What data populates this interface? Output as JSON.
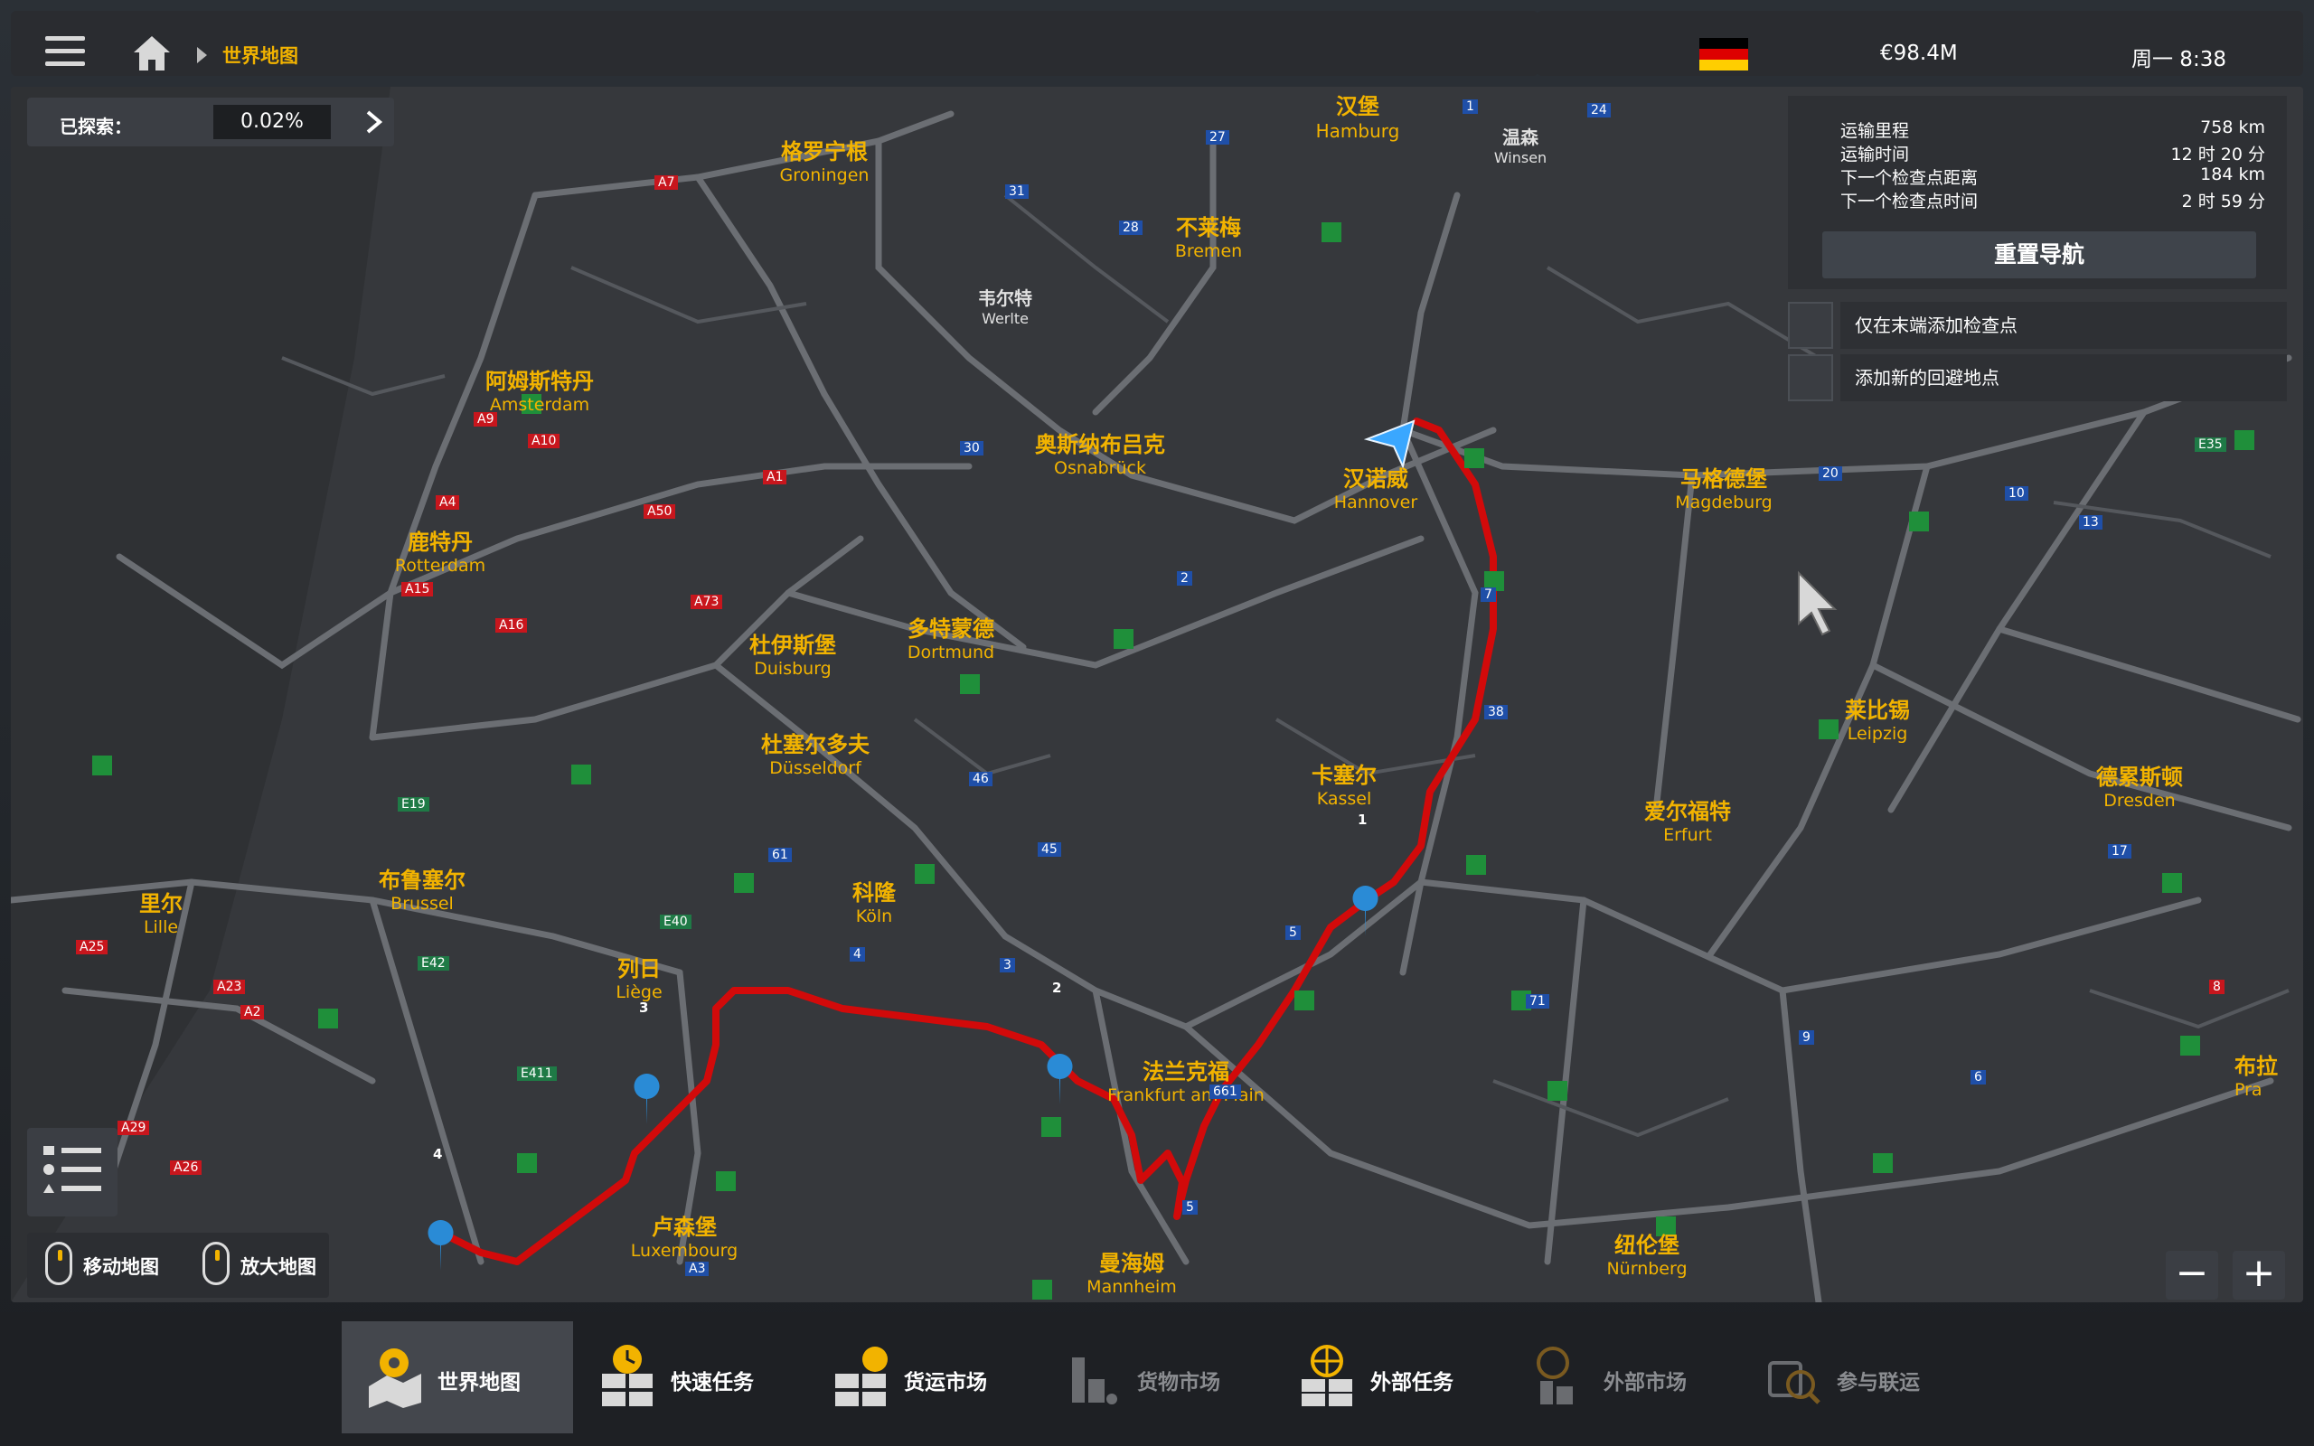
{
  "topbar": {
    "breadcrumb": "世界地图",
    "money": "€98.4M",
    "clock": "周一 8:38",
    "flag_colors": [
      "#000000",
      "#dd0000",
      "#ffce00"
    ]
  },
  "explored": {
    "label": "已探索：",
    "value": "0.02%"
  },
  "route_info": {
    "rows": [
      {
        "label": "运输里程",
        "value": "758 km"
      },
      {
        "label": "运输时间",
        "value": "12 时 20 分"
      },
      {
        "label": "下一个检查点距离",
        "value": "184 km"
      },
      {
        "label": "下一个检查点时间",
        "value": "2 时 59 分"
      }
    ],
    "reset_button": "重置导航",
    "option_end_checkpoint": "仅在末端添加检查点",
    "option_new_waypoint": "添加新的回避地点"
  },
  "map": {
    "route_color": "#d20a0a",
    "cities": [
      {
        "zh": "汉堡",
        "en": "Hamburg"
      },
      {
        "zh": "温森",
        "en": "Winsen"
      },
      {
        "zh": "格罗宁根",
        "en": "Groningen"
      },
      {
        "zh": "不莱梅",
        "en": "Bremen"
      },
      {
        "zh": "韦尔特",
        "en": "Werlte"
      },
      {
        "zh": "阿姆斯特丹",
        "en": "Amsterdam"
      },
      {
        "zh": "奥斯纳布吕克",
        "en": "Osnabrück"
      },
      {
        "zh": "汉诺威",
        "en": "Hannover"
      },
      {
        "zh": "马格德堡",
        "en": "Magdeburg"
      },
      {
        "zh": "鹿特丹",
        "en": "Rotterdam"
      },
      {
        "zh": "杜伊斯堡",
        "en": "Duisburg"
      },
      {
        "zh": "多特蒙德",
        "en": "Dortmund"
      },
      {
        "zh": "莱比锡",
        "en": "Leipzig"
      },
      {
        "zh": "杜塞尔多夫",
        "en": "Düsseldorf"
      },
      {
        "zh": "卡塞尔",
        "en": "Kassel"
      },
      {
        "zh": "德累斯顿",
        "en": "Dresden"
      },
      {
        "zh": "爱尔福特",
        "en": "Erfurt"
      },
      {
        "zh": "布鲁塞尔",
        "en": "Brussel"
      },
      {
        "zh": "里尔",
        "en": "Lille"
      },
      {
        "zh": "科隆",
        "en": "Köln"
      },
      {
        "zh": "列日",
        "en": "Liège"
      },
      {
        "zh": "法兰克福",
        "en": "Frankfurt am Main"
      },
      {
        "zh": "布拉",
        "en": "Pra"
      },
      {
        "zh": "卢森堡",
        "en": "Luxembourg"
      },
      {
        "zh": "纽伦堡",
        "en": "Nürnberg"
      },
      {
        "zh": "曼海姆",
        "en": "Mannheim"
      }
    ],
    "road_labels": [
      "A7",
      "31",
      "27",
      "28",
      "1",
      "A1",
      "30",
      "A50",
      "A73",
      "A16",
      "A15",
      "A4",
      "A9",
      "A10",
      "E19",
      "A25",
      "A23",
      "A2",
      "A29",
      "A26",
      "E42",
      "E40",
      "E411",
      "A3",
      "2",
      "3",
      "4",
      "45",
      "46",
      "61",
      "5",
      "7",
      "38",
      "71",
      "9",
      "6",
      "10",
      "13",
      "24",
      "20",
      "8",
      "17",
      "661",
      "E35",
      "5"
    ],
    "waypoints": [
      "1",
      "2",
      "3",
      "4"
    ]
  },
  "controls": {
    "move_map": "移动地图",
    "zoom_map": "放大地图",
    "zoom_out": "−",
    "zoom_in": "+"
  },
  "bottom_nav": [
    {
      "label": "世界地图",
      "active": true,
      "dim": false,
      "icon": "world-map-icon"
    },
    {
      "label": "快速任务",
      "active": false,
      "dim": false,
      "icon": "quick-job-icon"
    },
    {
      "label": "货运市场",
      "active": false,
      "dim": false,
      "icon": "freight-market-icon"
    },
    {
      "label": "货物市场",
      "active": false,
      "dim": true,
      "icon": "cargo-market-icon"
    },
    {
      "label": "外部任务",
      "active": false,
      "dim": false,
      "icon": "external-jobs-icon"
    },
    {
      "label": "外部市场",
      "active": false,
      "dim": true,
      "icon": "external-market-icon"
    },
    {
      "label": "参与联运",
      "active": false,
      "dim": true,
      "icon": "convoy-icon"
    }
  ]
}
